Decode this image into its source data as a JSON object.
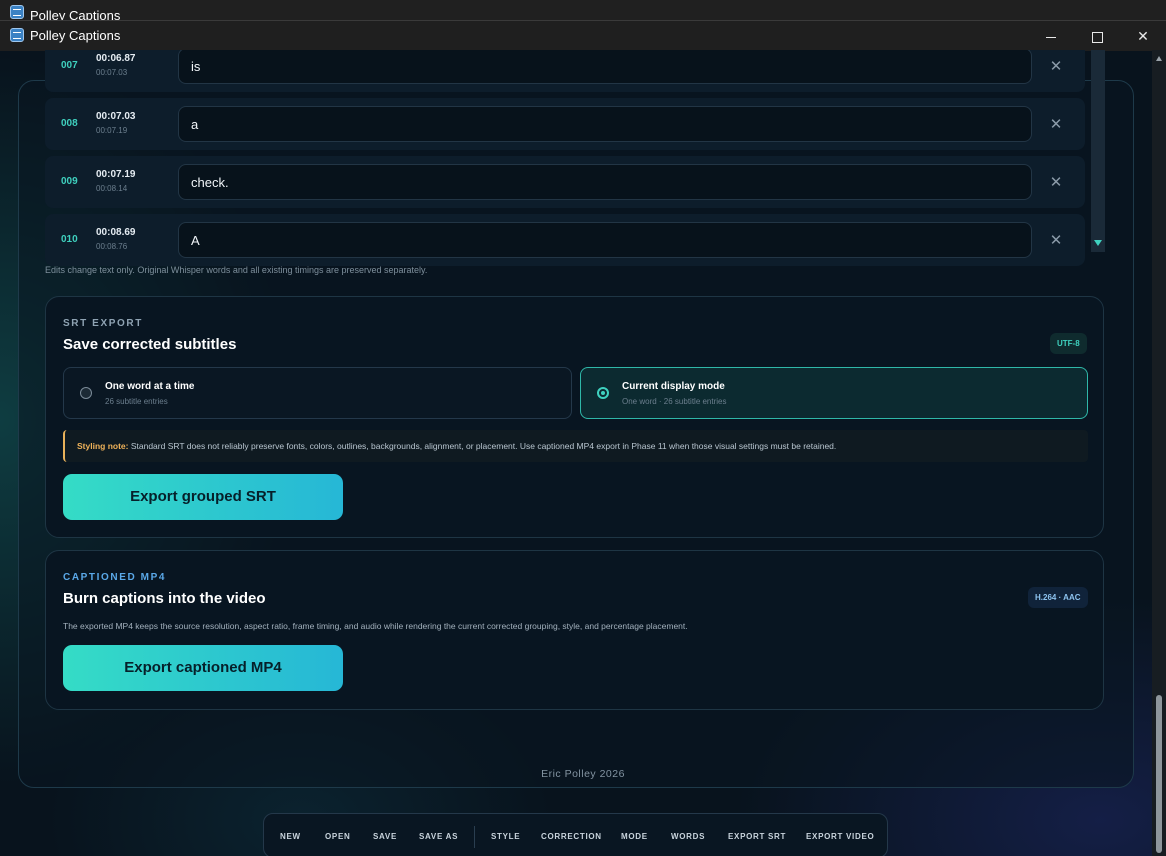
{
  "window": {
    "title": "Polley Captions"
  },
  "words": [
    {
      "num": "007",
      "start": "00:06.87",
      "end": "00:07.03",
      "text": "is"
    },
    {
      "num": "008",
      "start": "00:07.03",
      "end": "00:07.19",
      "text": "a"
    },
    {
      "num": "009",
      "start": "00:07.19",
      "end": "00:08.14",
      "text": "check."
    },
    {
      "num": "010",
      "start": "00:08.69",
      "end": "00:08.76",
      "text": "A"
    }
  ],
  "edit_note": "Edits change text only. Original Whisper words and all existing timings are preserved separately.",
  "srt_export": {
    "eyebrow": "SRT EXPORT",
    "title": "Save corrected subtitles",
    "badge": "UTF-8",
    "options": [
      {
        "label": "One word at a time",
        "sub": "26 subtitle entries",
        "selected": false
      },
      {
        "label": "Current display mode",
        "sub": "One word · 26 subtitle entries",
        "selected": true
      }
    ],
    "note_label": "Styling note:",
    "note_text": " Standard SRT does not reliably preserve fonts, colors, outlines, backgrounds, alignment, or placement. Use captioned MP4 export in Phase 11 when those visual settings must be retained.",
    "button": "Export grouped SRT"
  },
  "mp4_export": {
    "eyebrow": "CAPTIONED MP4",
    "title": "Burn captions into the video",
    "badge": "H.264 · AAC",
    "description": "The exported MP4 keeps the source resolution, aspect ratio, frame timing, and audio while rendering the current corrected grouping, style, and percentage placement.",
    "button": "Export captioned MP4"
  },
  "footer": "Eric Polley 2026",
  "toolbar": [
    "NEW",
    "OPEN",
    "SAVE",
    "SAVE AS",
    "STYLE",
    "CORRECTION",
    "MODE",
    "WORDS",
    "EXPORT SRT",
    "EXPORT VIDEO"
  ],
  "colors": {
    "accent": "#3fd1bf",
    "mp4_accent": "#5aa8e8",
    "warning": "#e8b15a"
  }
}
